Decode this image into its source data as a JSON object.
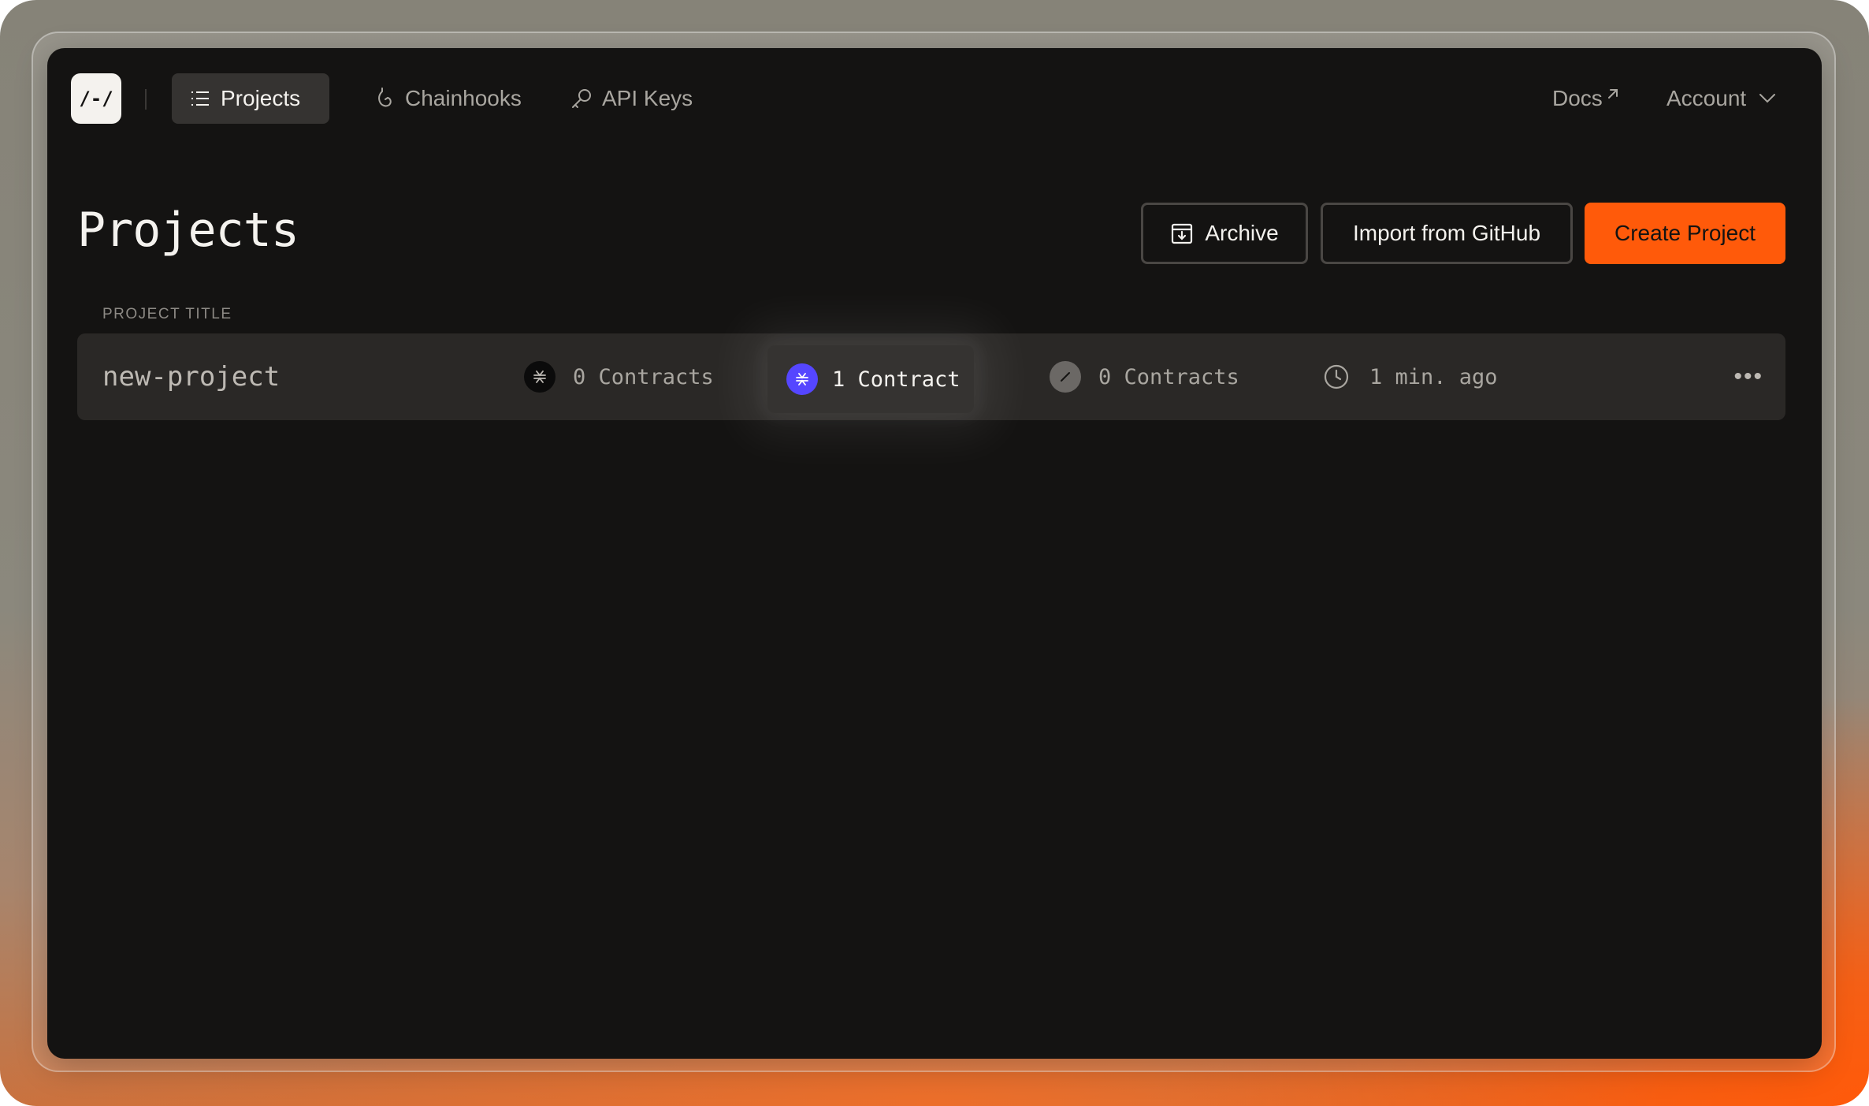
{
  "nav": {
    "logo_text": "/-/",
    "items": [
      {
        "label": "Projects",
        "icon": "list-icon",
        "active": true
      },
      {
        "label": "Chainhooks",
        "icon": "hook-icon",
        "active": false
      },
      {
        "label": "API Keys",
        "icon": "key-icon",
        "active": false
      }
    ],
    "docs_label": "Docs",
    "docs_icon": "external-link-icon",
    "account_label": "Account",
    "account_icon": "chevron-down-icon"
  },
  "page": {
    "title": "Projects",
    "archive_label": "Archive",
    "import_label": "Import from GitHub",
    "create_label": "Create Project",
    "accent_color": "#ff5a0a"
  },
  "table": {
    "column_header": "PROJECT TITLE",
    "rows": [
      {
        "title": "new-project",
        "stats": [
          {
            "label": "0 Contracts",
            "icon": "stacks-icon"
          },
          {
            "label": "1 Contract",
            "icon": "stacks-icon",
            "highlighted": true,
            "color": "#5546ff"
          },
          {
            "label": "0 Contracts",
            "icon": "slash-icon"
          },
          {
            "label": "1 min. ago",
            "icon": "clock-icon"
          }
        ],
        "menu": "•••"
      }
    ]
  }
}
